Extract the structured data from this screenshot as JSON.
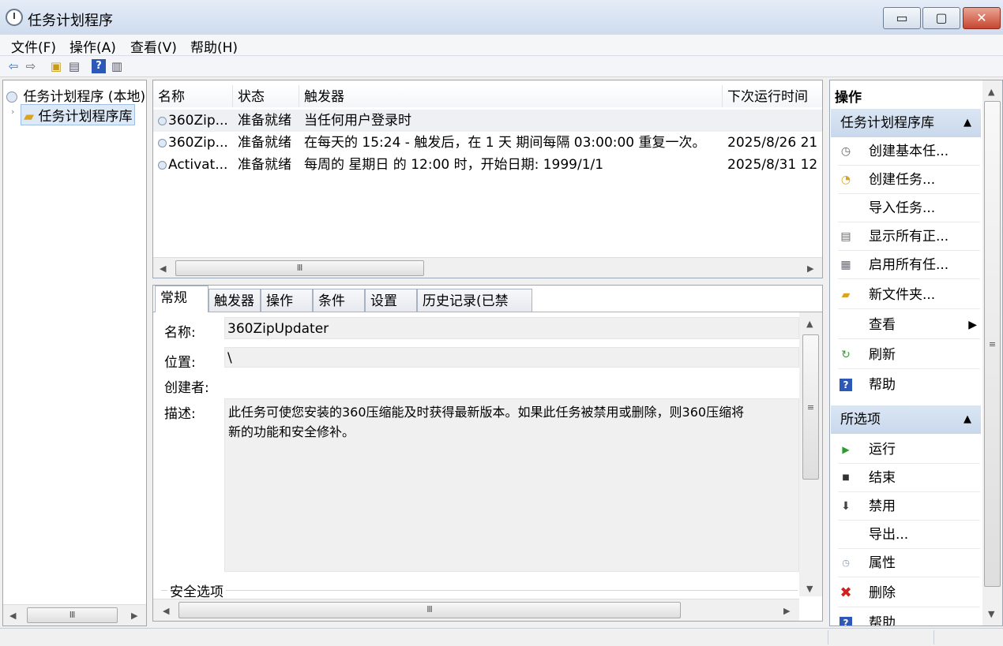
{
  "window": {
    "title": "任务计划程序",
    "btn_min": "▭",
    "btn_max": "▢",
    "btn_close": "✕"
  },
  "menu": [
    "文件(F)",
    "操作(A)",
    "查看(V)",
    "帮助(H)"
  ],
  "tree": {
    "root": "任务计划程序 (本地)",
    "child": "任务计划程序库"
  },
  "tasks": {
    "columns": [
      "名称",
      "状态",
      "触发器",
      "下次运行时间"
    ],
    "rows": [
      {
        "name": "360Zip...",
        "status": "准备就绪",
        "trigger": "当任何用户登录时",
        "next": ""
      },
      {
        "name": "360Zip...",
        "status": "准备就绪",
        "trigger": "在每天的 15:24 - 触发后，在 1 天 期间每隔 03:00:00 重复一次。",
        "next": "2025/8/26 21"
      },
      {
        "name": "Activat...",
        "status": "准备就绪",
        "trigger": "每周的 星期日 的 12:00 时，开始日期: 1999/1/1",
        "next": "2025/8/31 12"
      }
    ]
  },
  "detail": {
    "tabs": [
      "常规",
      "触发器",
      "操作",
      "条件",
      "设置",
      "历史记录(已禁用)"
    ],
    "name_label": "名称:",
    "name_value": "360ZipUpdater",
    "location_label": "位置:",
    "location_value": "\\",
    "author_label": "创建者:",
    "desc_label": "描述:",
    "desc_line1": "此任务可使您安装的360压缩能及时获得最新版本。如果此任务被禁用或删除，则360压缩将",
    "desc_line2": "新的功能和安全修补。",
    "security_label": "安全选项"
  },
  "actions": {
    "title": "操作",
    "section1": "任务计划程序库",
    "items1": [
      "创建基本任...",
      "创建任务...",
      "导入任务...",
      "显示所有正...",
      "启用所有任...",
      "新文件夹...",
      "查看",
      "刷新",
      "帮助"
    ],
    "section2": "所选项",
    "items2": [
      "运行",
      "结束",
      "禁用",
      "导出...",
      "属性",
      "删除",
      "帮助"
    ]
  },
  "scroll_glyph": "Ⅲ"
}
